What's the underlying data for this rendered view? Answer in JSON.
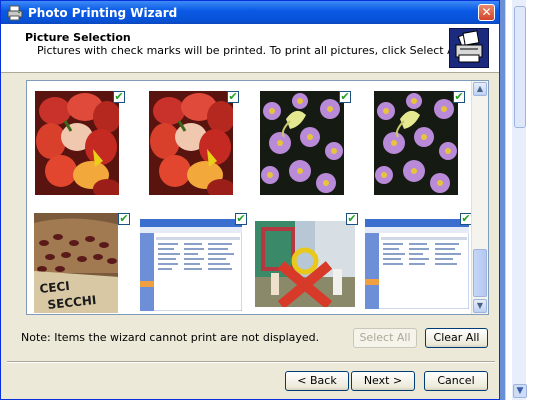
{
  "window": {
    "title": "Photo Printing Wizard",
    "close_label": "✕"
  },
  "header": {
    "title": "Picture Selection",
    "subtitle": "Pictures with check marks will be printed.  To print all pictures, click Select All."
  },
  "thumbnails": [
    {
      "name": "chili-peppers-1",
      "checked": true
    },
    {
      "name": "chili-peppers-2",
      "checked": true
    },
    {
      "name": "flowers-butterfly-1",
      "checked": true
    },
    {
      "name": "flowers-butterfly-2",
      "checked": true
    },
    {
      "name": "beans-sack",
      "checked": true,
      "sign_text": "CECI SECCHI"
    },
    {
      "name": "screenshot-1",
      "checked": true
    },
    {
      "name": "sculpture-photo",
      "checked": true
    },
    {
      "name": "screenshot-2",
      "checked": true
    }
  ],
  "check_glyph": "✔",
  "note": "Note: Items the wizard cannot print are not displayed.",
  "buttons": {
    "select_all": "Select All",
    "clear_all": "Clear All",
    "back": "< Back",
    "next": "Next >",
    "cancel": "Cancel"
  },
  "scroll_glyphs": {
    "up": "▲",
    "down": "▼"
  }
}
